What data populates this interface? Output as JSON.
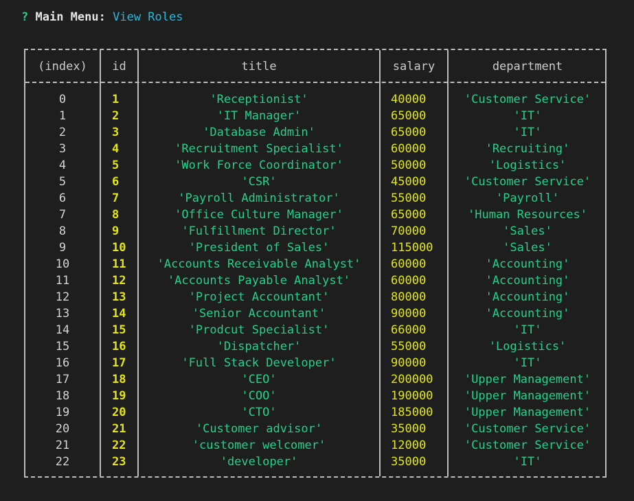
{
  "prompt": {
    "question_mark": "?",
    "label": "Main Menu:",
    "value": "View Roles"
  },
  "table": {
    "columns": [
      "(index)",
      "id",
      "title",
      "salary",
      "department"
    ],
    "rows": [
      {
        "index": "0",
        "id": "1",
        "title": "'Receptionist'",
        "salary": "40000",
        "department": "'Customer Service'"
      },
      {
        "index": "1",
        "id": "2",
        "title": "'IT Manager'",
        "salary": "65000",
        "department": "'IT'"
      },
      {
        "index": "2",
        "id": "3",
        "title": "'Database Admin'",
        "salary": "65000",
        "department": "'IT'"
      },
      {
        "index": "3",
        "id": "4",
        "title": "'Recruitment Specialist'",
        "salary": "60000",
        "department": "'Recruiting'"
      },
      {
        "index": "4",
        "id": "5",
        "title": "'Work Force Coordinator'",
        "salary": "50000",
        "department": "'Logistics'"
      },
      {
        "index": "5",
        "id": "6",
        "title": "'CSR'",
        "salary": "45000",
        "department": "'Customer Service'"
      },
      {
        "index": "6",
        "id": "7",
        "title": "'Payroll Administrator'",
        "salary": "55000",
        "department": "'Payroll'"
      },
      {
        "index": "7",
        "id": "8",
        "title": "'Office Culture Manager'",
        "salary": "65000",
        "department": "'Human Resources'"
      },
      {
        "index": "8",
        "id": "9",
        "title": "'Fulfillment Director'",
        "salary": "70000",
        "department": "'Sales'"
      },
      {
        "index": "9",
        "id": "10",
        "title": "'President of Sales'",
        "salary": "115000",
        "department": "'Sales'"
      },
      {
        "index": "10",
        "id": "11",
        "title": "'Accounts Receivable Analyst'",
        "salary": "60000",
        "department": "'Accounting'"
      },
      {
        "index": "11",
        "id": "12",
        "title": "'Accounts Payable Analyst'",
        "salary": "60000",
        "department": "'Accounting'"
      },
      {
        "index": "12",
        "id": "13",
        "title": "'Project Accountant'",
        "salary": "80000",
        "department": "'Accounting'"
      },
      {
        "index": "13",
        "id": "14",
        "title": "'Senior Accountant'",
        "salary": "90000",
        "department": "'Accounting'"
      },
      {
        "index": "14",
        "id": "15",
        "title": "'Prodcut Specialist'",
        "salary": "66000",
        "department": "'IT'"
      },
      {
        "index": "15",
        "id": "16",
        "title": "'Dispatcher'",
        "salary": "55000",
        "department": "'Logistics'"
      },
      {
        "index": "16",
        "id": "17",
        "title": "'Full Stack Developer'",
        "salary": "90000",
        "department": "'IT'"
      },
      {
        "index": "17",
        "id": "18",
        "title": "'CEO'",
        "salary": "200000",
        "department": "'Upper Management'"
      },
      {
        "index": "18",
        "id": "19",
        "title": "'COO'",
        "salary": "190000",
        "department": "'Upper Management'"
      },
      {
        "index": "19",
        "id": "20",
        "title": "'CTO'",
        "salary": "185000",
        "department": "'Upper Management'"
      },
      {
        "index": "20",
        "id": "21",
        "title": "'Customer advisor'",
        "salary": "35000",
        "department": "'Customer Service'"
      },
      {
        "index": "21",
        "id": "22",
        "title": "'customer welcomer'",
        "salary": "12000",
        "department": "'Customer Service'"
      },
      {
        "index": "22",
        "id": "23",
        "title": "'developer'",
        "salary": "35000",
        "department": "'IT'"
      }
    ]
  }
}
